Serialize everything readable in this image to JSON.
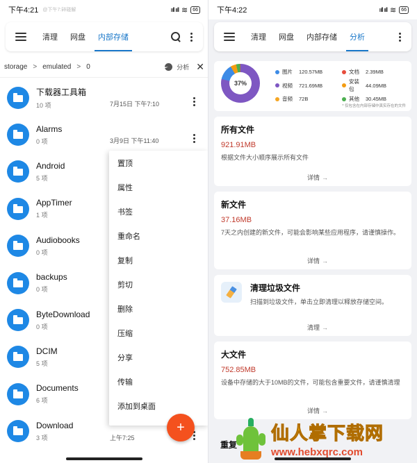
{
  "left": {
    "status": {
      "time": "下午4:21",
      "watermark": "@下午7:碎碰解",
      "signal": "ııll ııll",
      "wifi": "≋",
      "battery": "66"
    },
    "appbar": {
      "tabs": [
        {
          "label": "清理",
          "active": false
        },
        {
          "label": "网盘",
          "active": false
        },
        {
          "label": "内部存储",
          "active": true
        }
      ]
    },
    "breadcrumb": {
      "items": [
        "storage",
        "emulated",
        "0"
      ],
      "analyze_label": "分析"
    },
    "files": [
      {
        "name": "下载器工具箱",
        "count": "10 项",
        "date": "7月15日 下午7:10"
      },
      {
        "name": "Alarms",
        "count": "0 项",
        "date": "3月9日 下午11:40"
      },
      {
        "name": "Android",
        "count": "5 项",
        "date": ""
      },
      {
        "name": "AppTimer",
        "count": "1 项",
        "date": ""
      },
      {
        "name": "Audiobooks",
        "count": "0 项",
        "date": ""
      },
      {
        "name": "backups",
        "count": "0 项",
        "date": ""
      },
      {
        "name": "ByteDownload",
        "count": "0 项",
        "date": ""
      },
      {
        "name": "DCIM",
        "count": "5 项",
        "date": ""
      },
      {
        "name": "Documents",
        "count": "6 项",
        "date": ""
      },
      {
        "name": "Download",
        "count": "3 项",
        "date": "上午7:25"
      }
    ],
    "context_menu": [
      "置顶",
      "属性",
      "书签",
      "重命名",
      "复制",
      "剪切",
      "删除",
      "压缩",
      "分享",
      "传输",
      "添加到桌面"
    ],
    "fab_symbol": "+"
  },
  "right": {
    "status": {
      "time": "下午4:22",
      "signal": "ııll ııll",
      "wifi": "≋",
      "battery": "66"
    },
    "appbar": {
      "tabs": [
        {
          "label": "清理",
          "active": false
        },
        {
          "label": "网盘",
          "active": false
        },
        {
          "label": "内部存储",
          "active": false
        },
        {
          "label": "分析",
          "active": true
        }
      ]
    },
    "storage": {
      "percent": "37%",
      "percent_value": 37,
      "legend": [
        {
          "name": "图片",
          "size": "120.57MB",
          "color": "#3d8be6"
        },
        {
          "name": "文档",
          "size": "2.39MB",
          "color": "#e74c3c"
        },
        {
          "name": "视频",
          "size": "721.69MB",
          "color": "#7e57c2"
        },
        {
          "name": "安装包",
          "size": "44.09MB",
          "color": "#f39c12"
        },
        {
          "name": "音频",
          "size": "72B",
          "color": "#f5a623"
        },
        {
          "name": "其他",
          "size": "30.45MB",
          "color": "#4caf50"
        }
      ],
      "note": "* 仅包含在内部存储中真实存在的文件"
    },
    "cards": {
      "all_files": {
        "title": "所有文件",
        "size": "921.91MB",
        "desc": "根据文件大小顺序展示所有文件",
        "detail": "详情"
      },
      "new_files": {
        "title": "新文件",
        "size": "37.16MB",
        "desc": "7天之内创建的新文件，可能会影响某些应用程序，请谨慎操作。",
        "detail": "详情"
      },
      "clean": {
        "title": "清理垃圾文件",
        "desc": "扫描到垃圾文件，单击立即清理以释放存储空间。",
        "detail": "清理"
      },
      "large_files": {
        "title": "大文件",
        "size": "752.85MB",
        "desc": "设备中存储的大于10MB的文件，可能包含重要文件，请谨慎清理",
        "detail": "详情"
      },
      "partial_title": "重复"
    },
    "promo": {
      "title": "仙人掌下载网",
      "url": "www.hebxqrc.com"
    }
  }
}
